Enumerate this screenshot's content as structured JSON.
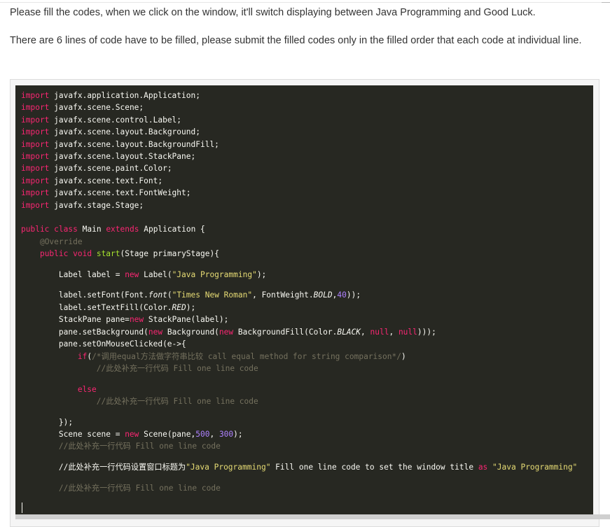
{
  "instructions": {
    "line1": "Please fill the codes, when we click on the window, it'll switch displaying between Java Programming and Good Luck.",
    "line2": "There are 6 lines of code have to be filled, please submit the filled codes only in the filled order that each code at individual line."
  },
  "code": {
    "import_kw": "import",
    "imports": [
      "javafx.application.Application;",
      "javafx.scene.Scene;",
      "javafx.scene.control.Label;",
      "javafx.scene.layout.Background;",
      "javafx.scene.layout.BackgroundFill;",
      "javafx.scene.layout.StackPane;",
      "javafx.scene.paint.Color;",
      "javafx.scene.text.Font;",
      "javafx.scene.text.FontWeight;",
      "javafx.stage.Stage;"
    ],
    "class_decl": {
      "public": "public",
      "class": "class",
      "name": "Main",
      "extends": "extends",
      "parent": "Application",
      "brace": " {"
    },
    "annotation": "@Override",
    "start_decl": {
      "public": "public",
      "void": "void",
      "name": "start",
      "params": "(Stage primaryStage){"
    },
    "label_line": {
      "a": "Label label = ",
      "new": "new",
      "b": " Label(",
      "str": "\"Java Programming\"",
      "c": ");"
    },
    "setfont_line": {
      "a": "label.setFont(Font.",
      "font": "font",
      "b": "(",
      "str": "\"Times New Roman\"",
      "c": ", FontWeight.",
      "bold": "BOLD",
      "d": ",",
      "num": "40",
      "e": "));"
    },
    "settextfill_line": {
      "a": "label.setTextFill(Color.",
      "red": "RED",
      "b": ");"
    },
    "stackpane_line": {
      "a": "StackPane pane=",
      "new": "new",
      "b": " StackPane(label);"
    },
    "setbackground_line": {
      "a": "pane.setBackground(",
      "new1": "new",
      "b": " Background(",
      "new2": "new",
      "c": " BackgroundFill(Color.",
      "black": "BLACK",
      "d": ", ",
      "null1": "null",
      "e": ", ",
      "null2": "null",
      "f": ")));"
    },
    "onclick_line": "pane.setOnMouseClicked(e->{",
    "if_line": {
      "if": "if",
      "a": "(",
      "comment": "/*调用equal方法做字符串比较 call equal method for string comparison*/",
      "b": ")"
    },
    "fill_comment": "//此处补充一行代码 Fill one line code",
    "else": "else",
    "close_lambda": "});",
    "scene_line": {
      "a": "Scene scene = ",
      "new": "new",
      "b": " Scene(pane,",
      "num1": "500",
      "c": ", ",
      "num2": "300",
      "d": ");"
    },
    "title_line": {
      "a": "//此处补充一行代码设置窗口标题为",
      "str1": "\"Java Programming\"",
      "b": " Fill one line code to set the window title ",
      "as": "as",
      "c": " ",
      "str2": "\"Java Programming\""
    }
  }
}
